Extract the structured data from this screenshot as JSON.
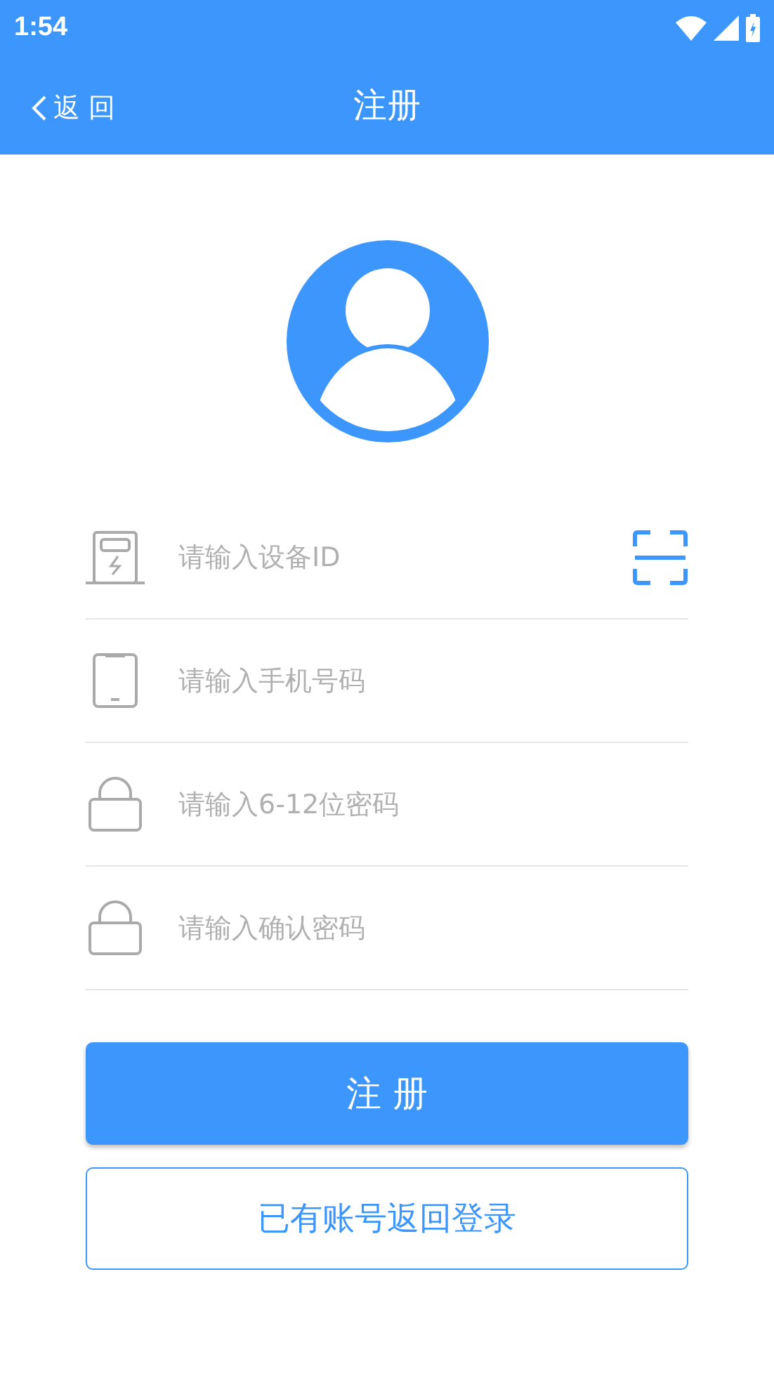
{
  "status_bar": {
    "time": "1:54"
  },
  "nav_bar": {
    "back": "返 回",
    "title": "注册"
  },
  "fields": [
    {
      "kind": "device",
      "placeholder": "请输入设备ID",
      "scan": true
    },
    {
      "kind": "phone",
      "placeholder": "请输入手机号码",
      "scan": false
    },
    {
      "kind": "lock",
      "placeholder": "请输入6-12位密码",
      "scan": false
    },
    {
      "kind": "lock",
      "placeholder": "请输入确认密码",
      "scan": false
    }
  ],
  "register_button": "注 册",
  "login_link": "已有账号返回登录"
}
